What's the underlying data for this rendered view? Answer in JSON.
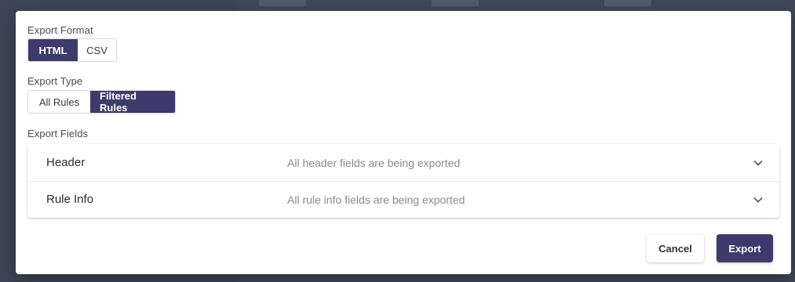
{
  "dialog": {
    "format": {
      "label": "Export Format",
      "options": [
        {
          "label": "HTML",
          "selected": true
        },
        {
          "label": "CSV",
          "selected": false
        }
      ]
    },
    "type": {
      "label": "Export Type",
      "options": [
        {
          "label": "All Rules",
          "selected": false
        },
        {
          "label": "Filtered Rules",
          "selected": true
        }
      ]
    },
    "fields": {
      "label": "Export Fields",
      "items": [
        {
          "name": "Header",
          "description": "All header fields are being exported",
          "icon": "chevron-down-icon"
        },
        {
          "name": "Rule Info",
          "description": "All rule info fields are being exported",
          "icon": "chevron-down-icon"
        }
      ]
    },
    "actions": {
      "cancel_label": "Cancel",
      "export_label": "Export"
    }
  },
  "colors": {
    "accent": "#3d3b6b",
    "backdrop": "#3b4252"
  }
}
